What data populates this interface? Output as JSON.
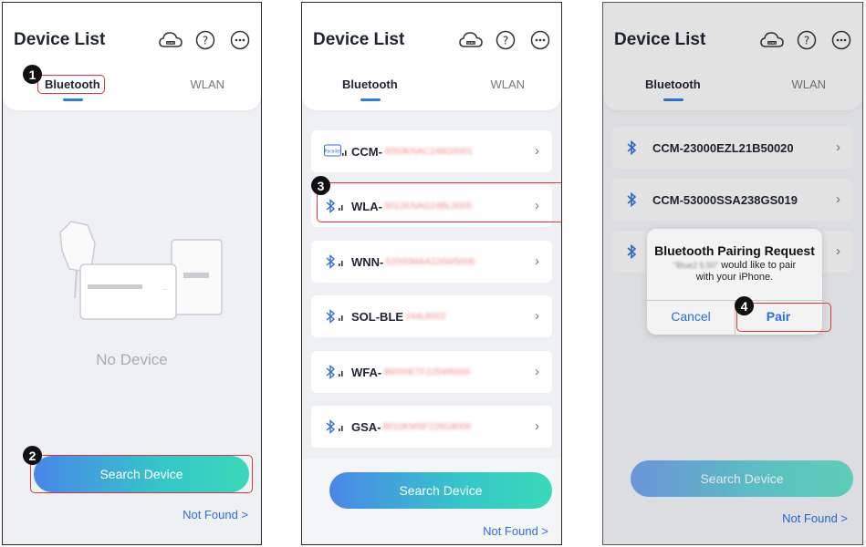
{
  "header": {
    "title": "Device List",
    "tab_bluetooth": "Bluetooth",
    "tab_wlan": "WLAN",
    "cloud_icon_label": "SEMS"
  },
  "screen1": {
    "empty_text": "No Device",
    "search_button": "Search Device",
    "not_found": "Not Found >"
  },
  "screen2": {
    "devices": [
      {
        "prefix": "CCM-",
        "hidden": "4050KNAC248G0001",
        "icon": "parallel-icon"
      },
      {
        "prefix": "WLA-",
        "hidden": "5012KNAG24BL0005",
        "icon": "bluetooth-icon"
      },
      {
        "prefix": "WNN-",
        "hidden": "52000MAA226W5006",
        "icon": "bluetooth-icon"
      },
      {
        "prefix": "SOL-BLE",
        "hidden": "244L8002",
        "icon": "bluetooth-icon"
      },
      {
        "prefix": "WFA-",
        "hidden": "96000ETF225W6666",
        "icon": "bluetooth-icon"
      },
      {
        "prefix": "GSA-",
        "hidden": "8010KMSF226G8006",
        "icon": "bluetooth-icon"
      }
    ],
    "search_button": "Search Device",
    "not_found": "Not Found >"
  },
  "screen3": {
    "devices": [
      {
        "name": "CCM-23000EZL21B50020"
      },
      {
        "name": "CCM-53000SSA238GS019"
      }
    ],
    "dialog": {
      "title": "Bluetooth Pairing Request",
      "device_hidden": "\"Blue2 5.50\"",
      "message_a": "would like to pair",
      "message_b": "with your iPhone.",
      "cancel": "Cancel",
      "pair": "Pair"
    },
    "search_button": "Search Device",
    "not_found": "Not Found >"
  },
  "steps": [
    "1",
    "2",
    "3",
    "4"
  ],
  "colors": {
    "accent": "#2a7bea",
    "highlight": "#e0363c",
    "gradient_start": "#4a86e8",
    "gradient_end": "#3ad8b8",
    "bluetooth": "#2f6fd8"
  }
}
